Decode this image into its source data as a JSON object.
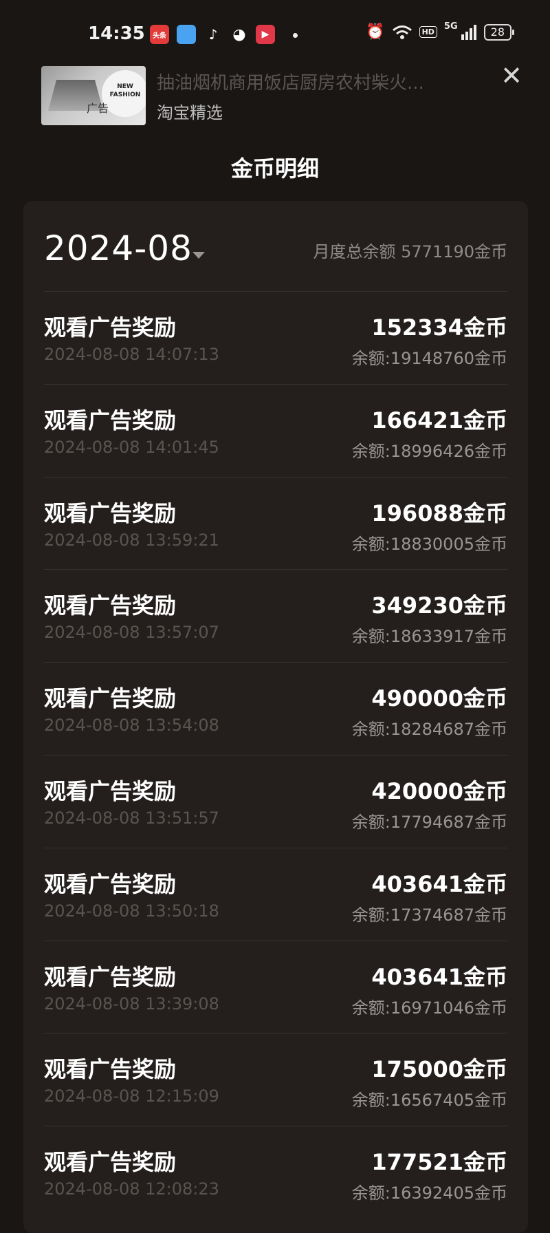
{
  "status_bar": {
    "time": "14:35",
    "apps": [
      {
        "name": "toutiao-icon",
        "label": "头条",
        "bg": "#e33a3a"
      },
      {
        "name": "blue-app-icon",
        "label": "",
        "bg": "#4aa3f0"
      },
      {
        "name": "tiktok-icon",
        "label": "♪",
        "bg": "transparent"
      },
      {
        "name": "wechat-icon",
        "label": "◕",
        "bg": "transparent"
      },
      {
        "name": "video-app-icon",
        "label": "▶",
        "bg": "#e03848"
      }
    ],
    "network": "5G",
    "hd": "HD",
    "battery": "28"
  },
  "ad": {
    "title": "抽油烟机商用饭店厨房农村柴火...",
    "subtitle": "淘宝精选",
    "thumb_text": "NEW FASHION",
    "thumb_tag": "广告"
  },
  "page": {
    "title": "金币明细"
  },
  "month": {
    "label": "2024-08",
    "summary": "月度总余额 5771190金币"
  },
  "records": [
    {
      "title": "观看广告奖励",
      "time": "2024-08-08 14:07:13",
      "amount": "152334金币",
      "balance": "余额:19148760金币"
    },
    {
      "title": "观看广告奖励",
      "time": "2024-08-08 14:01:45",
      "amount": "166421金币",
      "balance": "余额:18996426金币"
    },
    {
      "title": "观看广告奖励",
      "time": "2024-08-08 13:59:21",
      "amount": "196088金币",
      "balance": "余额:18830005金币"
    },
    {
      "title": "观看广告奖励",
      "time": "2024-08-08 13:57:07",
      "amount": "349230金币",
      "balance": "余额:18633917金币"
    },
    {
      "title": "观看广告奖励",
      "time": "2024-08-08 13:54:08",
      "amount": "490000金币",
      "balance": "余额:18284687金币"
    },
    {
      "title": "观看广告奖励",
      "time": "2024-08-08 13:51:57",
      "amount": "420000金币",
      "balance": "余额:17794687金币"
    },
    {
      "title": "观看广告奖励",
      "time": "2024-08-08 13:50:18",
      "amount": "403641金币",
      "balance": "余额:17374687金币"
    },
    {
      "title": "观看广告奖励",
      "time": "2024-08-08 13:39:08",
      "amount": "403641金币",
      "balance": "余额:16971046金币"
    },
    {
      "title": "观看广告奖励",
      "time": "2024-08-08 12:15:09",
      "amount": "175000金币",
      "balance": "余额:16567405金币"
    },
    {
      "title": "观看广告奖励",
      "time": "2024-08-08 12:08:23",
      "amount": "177521金币",
      "balance": "余额:16392405金币"
    }
  ]
}
